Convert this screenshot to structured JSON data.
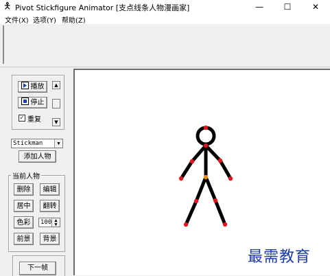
{
  "window": {
    "title": "Pivot Stickfigure Animator [支点线条人物漫画家]",
    "minimize": "—",
    "maximize": "☐",
    "close": "✕"
  },
  "menu": {
    "items": [
      "文件(X)",
      "选项(Y)",
      "帮助(Z)"
    ]
  },
  "playback": {
    "play_label": "播放",
    "stop_label": "停止",
    "repeat_label": "重复",
    "repeat_checked": true
  },
  "figure_select": {
    "value": "Stickman"
  },
  "add_figure_label": "添加人物",
  "current_figure": {
    "group_label": "当前人物",
    "delete_label": "删除",
    "edit_label": "编辑",
    "center_label": "居中",
    "flip_label": "翻转",
    "color_label": "色彩",
    "opacity_value": "100",
    "front_label": "前景",
    "back_label": "背景"
  },
  "next_frame_label": "下一帧",
  "watermark": "最需教育",
  "colors": {
    "joint_red": "#e8141c",
    "joint_orange": "#f08c00",
    "stick": "#000000",
    "watermark": "#1c3aa8"
  }
}
